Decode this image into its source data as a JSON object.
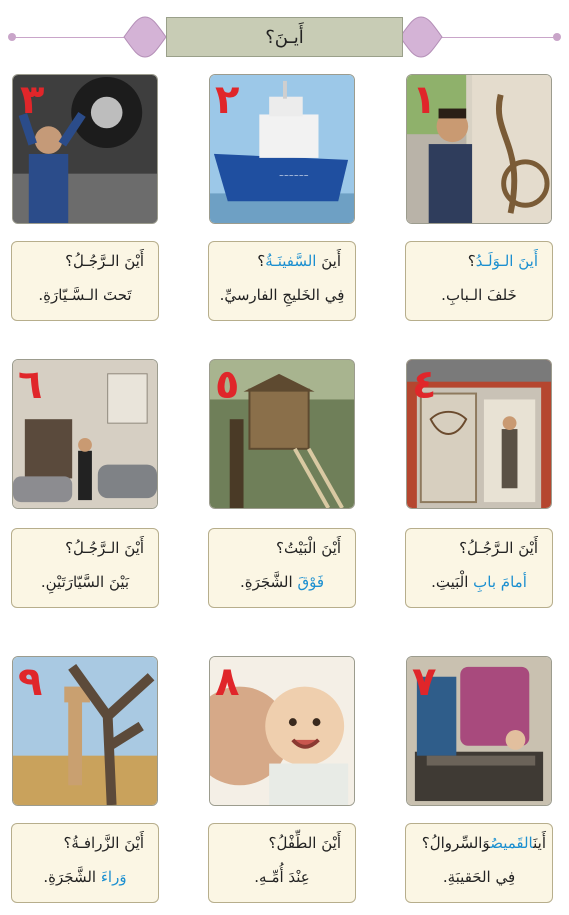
{
  "title": "أَيـنَ؟",
  "items": [
    {
      "num": "١",
      "q_pre": "",
      "q_hl": "أَينَ الـوَلَـدُ",
      "q_post": "؟",
      "a_pre": "خَلفَ الـبابِ.",
      "a_hl": "",
      "a_post": ""
    },
    {
      "num": "٢",
      "q_pre": "أَينَ ",
      "q_hl": "السَّفينَـةُ",
      "q_post": "؟",
      "a_pre": "فِي الخَليجِ الفارسيِّ.",
      "a_hl": "",
      "a_post": ""
    },
    {
      "num": "٣",
      "q_pre": "أَيْنَ الـرَّجُـلُ؟",
      "q_hl": "",
      "q_post": "",
      "a_pre": "تَحتَ الـسَّـيّارَةِ.",
      "a_hl": "",
      "a_post": ""
    },
    {
      "num": "٤",
      "q_pre": "أَيْنَ الـرَّجُـلُ؟",
      "q_hl": "",
      "q_post": "",
      "a_pre": "",
      "a_hl": "أمامَ بابِ",
      "a_post": " الْبَيتِ."
    },
    {
      "num": "٥",
      "q_pre": "أَيْنَ الْبَيْتُ؟",
      "q_hl": "",
      "q_post": "",
      "a_pre": "",
      "a_hl": "فَوْقَ",
      "a_post": " الشَّجَرَةِ."
    },
    {
      "num": "٦",
      "q_pre": "أَيْنَ الـرَّجُـلُ؟",
      "q_hl": "",
      "q_post": "",
      "a_pre": "بَيْنَ السَّيّارَتَيْنِ.",
      "a_hl": "",
      "a_post": ""
    },
    {
      "num": "٧",
      "q_pre": "أَينَ",
      "q_hl": "القَميصُ",
      "q_post": "وَالسِّروالُ؟",
      "a_pre": "فِي الحَقيبَةِ.",
      "a_hl": "",
      "a_post": ""
    },
    {
      "num": "٨",
      "q_pre": "أَيْنَ الطِّفْلُ؟",
      "q_hl": "",
      "q_post": "",
      "a_pre": "عِنْدَ أُمِّـهِ.",
      "a_hl": "",
      "a_post": ""
    },
    {
      "num": "٩",
      "q_pre": "أَيْنَ الزَّرافـةُ؟",
      "q_hl": "",
      "q_post": "",
      "a_pre": "",
      "a_hl": "وَراءَ",
      "a_post": " الشَّجَرَةِ."
    }
  ]
}
